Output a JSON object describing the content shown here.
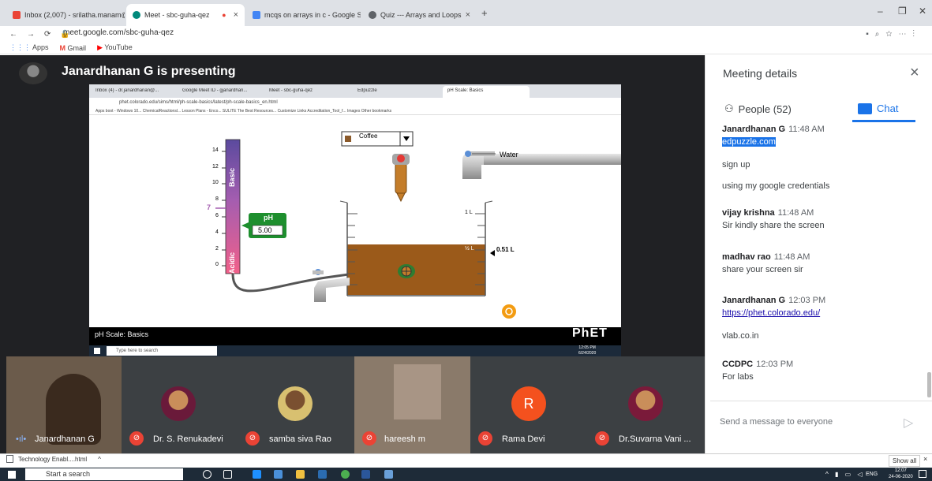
{
  "browser": {
    "tabs": [
      {
        "label": "Inbox (2,007) - srilatha.manam@...",
        "icon": "gmail-icon",
        "color": "#ea4335"
      },
      {
        "label": "Meet - sbc-guha-qez",
        "icon": "meet-icon",
        "color": "#00897b"
      },
      {
        "label": "mcqs on arrays in c - Google Se...",
        "icon": "google-icon",
        "color": "#4285f4"
      },
      {
        "label": "Quiz --- Arrays and Loops",
        "icon": "quiz-icon",
        "color": "#5f6368"
      }
    ],
    "url": "meet.google.com/sbc-guha-qez",
    "bookmarks": [
      "Apps",
      "Gmail",
      "YouTube"
    ]
  },
  "stage": {
    "presenter_text": "Janardhanan G is presenting",
    "shared": {
      "tabs": [
        "Inbox (4) - dr.janardhanan@...",
        "Google Meet ID - gjanardhan...",
        "Meet - sbc-guha-qez",
        "Edpuzzle",
        "pH Scale: Basics"
      ],
      "url": "phet.colorado.edu/sims/html/ph-scale-basics/latest/ph-scale-basics_en.html",
      "bookmarks": "Apps   boot - Windows 10...   ChemicalReactionsl...   Lesson Plans - Enco...   SULITE   The Best Resources...   Customize Links   Accreditation_Tool_f...   Images   Other bookmarks",
      "sim": {
        "solution": "Coffee",
        "water_label": "Water",
        "ph_label": "pH",
        "ph_value": "5.00",
        "basic_label": "Basic",
        "acidic_label": "Acidic",
        "neutral_mark": "7",
        "scale_ticks": [
          "14",
          "12",
          "10",
          "8",
          "6",
          "4",
          "2",
          "0"
        ],
        "volume_top": "1 L",
        "volume_half": "½ L",
        "volume_value": "0.51 L"
      },
      "sim_title": "pH Scale: Basics",
      "phet_logo": "PhET",
      "taskbar_search": "Type here to search",
      "clock_time": "12:05 PM",
      "clock_date": "6/24/2020"
    },
    "participants": [
      {
        "name": "Janardhanan G",
        "muted": false
      },
      {
        "name": "Dr. S. Renukadevi",
        "muted": true
      },
      {
        "name": "samba siva Rao",
        "muted": true
      },
      {
        "name": "hareesh m",
        "muted": true
      },
      {
        "name": "Rama Devi",
        "muted": true,
        "initial": "R"
      },
      {
        "name": "Dr.Suvarna Vani ...",
        "muted": true
      }
    ]
  },
  "panel": {
    "title": "Meeting details",
    "people_tab": "People (52)",
    "chat_tab": "Chat",
    "messages": [
      {
        "sender": "Janardhanan G",
        "time": "11:48 AM",
        "lines": [
          "edpuzzle.com",
          "sign up",
          "using my google credentials"
        ]
      },
      {
        "sender": "vijay krishna",
        "time": "11:48 AM",
        "lines": [
          "Sir kindly share the screen"
        ]
      },
      {
        "sender": "madhav rao",
        "time": "11:48 AM",
        "lines": [
          "share your screen sir"
        ]
      },
      {
        "sender": "Janardhanan G",
        "time": "12:03 PM",
        "lines": [
          "https://phet.colorado.edu/",
          "vlab.co.in"
        ]
      },
      {
        "sender": "CCDPC",
        "time": "12:03 PM",
        "lines": [
          "For labs"
        ]
      }
    ],
    "send_placeholder": "Send a message to everyone"
  },
  "download_bar": {
    "file": "Technology Enabl....html",
    "show_all": "Show all"
  },
  "taskbar": {
    "search": "Start a search",
    "time": "12:07",
    "date": "24-06-2020",
    "lang": "ENG"
  }
}
